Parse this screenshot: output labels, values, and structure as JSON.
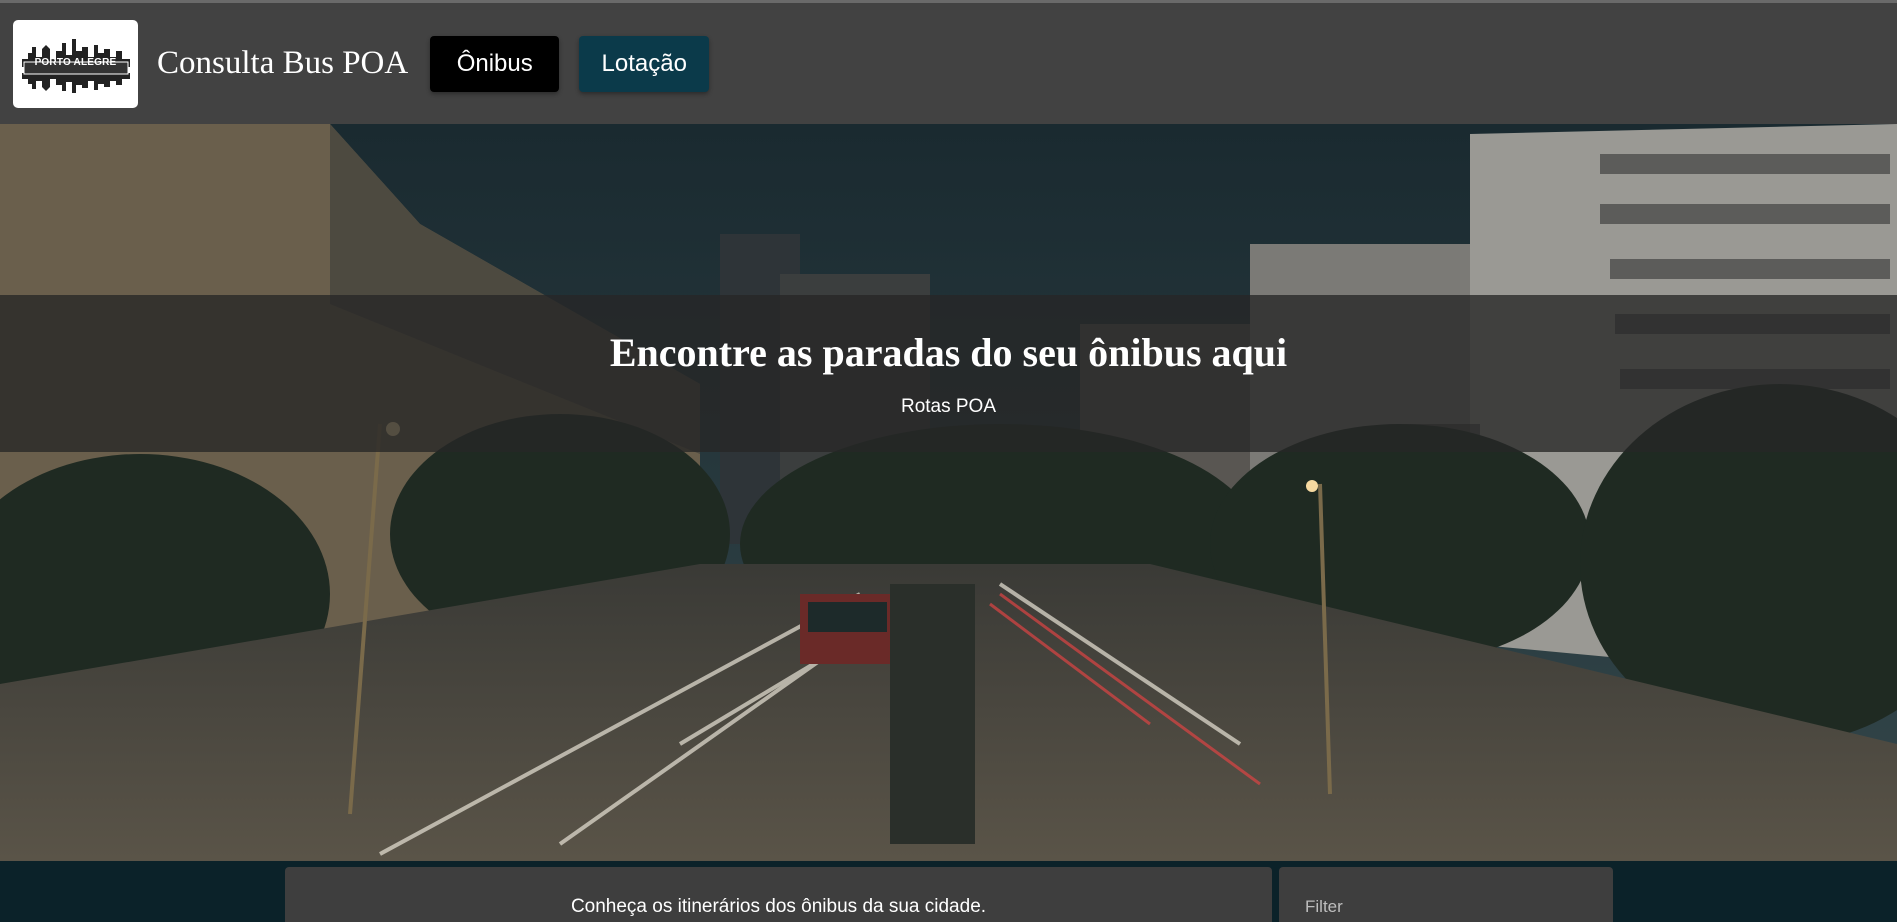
{
  "navbar": {
    "logo_text": "PORTO ALEGRE",
    "brand": "Consulta Bus POA",
    "buttons": [
      {
        "label": "Ônibus"
      },
      {
        "label": "Lotação"
      }
    ]
  },
  "hero": {
    "title": "Encontre as paradas do seu ônibus aqui",
    "subtitle": "Rotas POA"
  },
  "content": {
    "intro": "Conheça os itinerários dos ônibus da sua cidade.",
    "filter_placeholder": "Filter"
  },
  "colors": {
    "navbar_bg": "#424242",
    "page_bg": "#0b2229",
    "onibus_btn": "#000000",
    "lotacao_btn": "#0b3a4a",
    "card_bg": "#3e3e3e"
  }
}
